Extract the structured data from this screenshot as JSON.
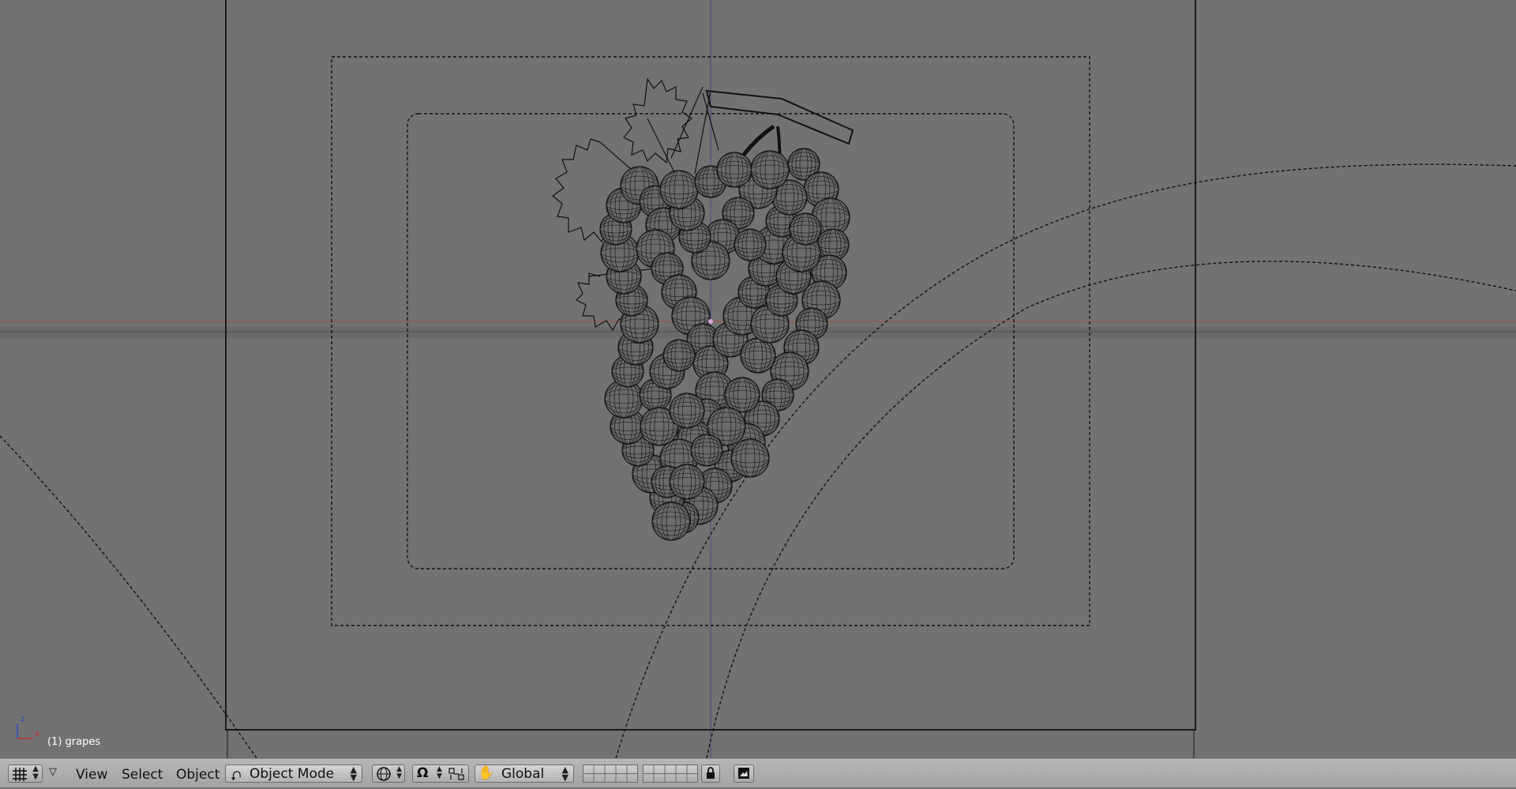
{
  "viewport": {
    "object_label": "(1) grapes",
    "axis_z": "z",
    "axis_x": "x"
  },
  "header": {
    "menu_view": "View",
    "menu_select": "Select",
    "menu_object": "Object",
    "mode_select": "Object Mode",
    "orientation_select": "Global"
  },
  "icons": {
    "editor_type": "grid-icon",
    "mode": "object-mode-icon",
    "shading": "viewport-shading-icon",
    "pivot": "pivot-point-icon",
    "manipulator": "manipulator-icon",
    "transform_space": "hand-icon",
    "lock": "lock-icon",
    "render": "render-icon"
  },
  "colors": {
    "viewport_bg": "#727272",
    "header_bg": "#b0b0b0",
    "x_axis_line": "#b0503a",
    "wire": "#111111"
  }
}
